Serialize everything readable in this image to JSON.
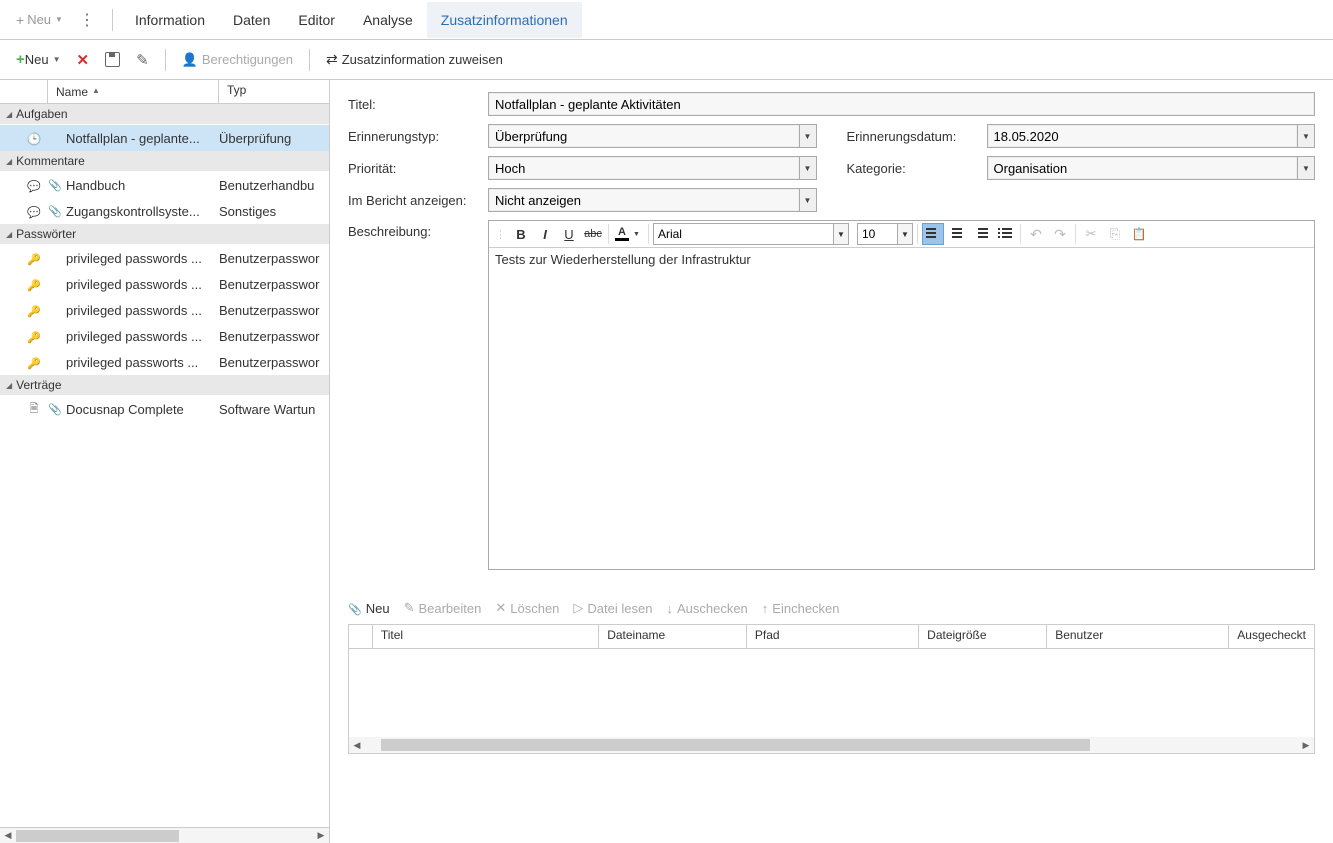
{
  "topbar": {
    "neu_label": "Neu",
    "tabs": [
      "Information",
      "Daten",
      "Editor",
      "Analyse",
      "Zusatzinformationen"
    ],
    "active_tab": 4
  },
  "toolbar2": {
    "neu_label": "Neu",
    "berechtigungen_label": "Berechtigungen",
    "zuweisen_label": "Zusatzinformation zuweisen"
  },
  "sidebar": {
    "col_name": "Name",
    "col_typ": "Typ",
    "groups": [
      {
        "label": "Aufgaben",
        "rows": [
          {
            "icon": "clock",
            "attach": false,
            "name": "Notfallplan - geplante...",
            "typ": "Überprüfung",
            "selected": true
          }
        ]
      },
      {
        "label": "Kommentare",
        "rows": [
          {
            "icon": "comment",
            "attach": true,
            "name": "Handbuch",
            "typ": "Benutzerhandbu"
          },
          {
            "icon": "comment",
            "attach": true,
            "name": "Zugangskontrollsyste...",
            "typ": "Sonstiges"
          }
        ]
      },
      {
        "label": "Passwörter",
        "rows": [
          {
            "icon": "key",
            "attach": false,
            "name": "privileged passwords ...",
            "typ": "Benutzerpasswor"
          },
          {
            "icon": "key",
            "attach": false,
            "name": "privileged passwords ...",
            "typ": "Benutzerpasswor"
          },
          {
            "icon": "key",
            "attach": false,
            "name": "privileged passwords ...",
            "typ": "Benutzerpasswor"
          },
          {
            "icon": "key",
            "attach": false,
            "name": "privileged passwords ...",
            "typ": "Benutzerpasswor"
          },
          {
            "icon": "key",
            "attach": false,
            "name": "privileged passworts ...",
            "typ": "Benutzerpasswor"
          }
        ]
      },
      {
        "label": "Verträge",
        "rows": [
          {
            "icon": "doc",
            "attach": true,
            "name": "Docusnap Complete",
            "typ": "Software Wartun"
          }
        ]
      }
    ]
  },
  "form": {
    "titel_lbl": "Titel:",
    "titel_val": "Notfallplan - geplante Aktivitäten",
    "erinnerungstyp_lbl": "Erinnerungstyp:",
    "erinnerungstyp_val": "Überprüfung",
    "erinnerungsdatum_lbl": "Erinnerungsdatum:",
    "erinnerungsdatum_val": "18.05.2020",
    "prioritaet_lbl": "Priorität:",
    "prioritaet_val": "Hoch",
    "kategorie_lbl": "Kategorie:",
    "kategorie_val": "Organisation",
    "bericht_lbl": "Im Bericht anzeigen:",
    "bericht_val": "Nicht anzeigen",
    "beschreibung_lbl": "Beschreibung:",
    "beschreibung_val": "Tests zur Wiederherstellung der Infrastruktur"
  },
  "editor": {
    "font_name": "Arial",
    "font_size": "10"
  },
  "attachments": {
    "toolbar": {
      "neu": "Neu",
      "bearbeiten": "Bearbeiten",
      "loeschen": "Löschen",
      "dateilesen": "Datei lesen",
      "auschecken": "Auschecken",
      "einchecken": "Einchecken"
    },
    "cols": [
      "Titel",
      "Dateiname",
      "Pfad",
      "Dateigröße",
      "Benutzer",
      "Ausgecheckt"
    ]
  }
}
